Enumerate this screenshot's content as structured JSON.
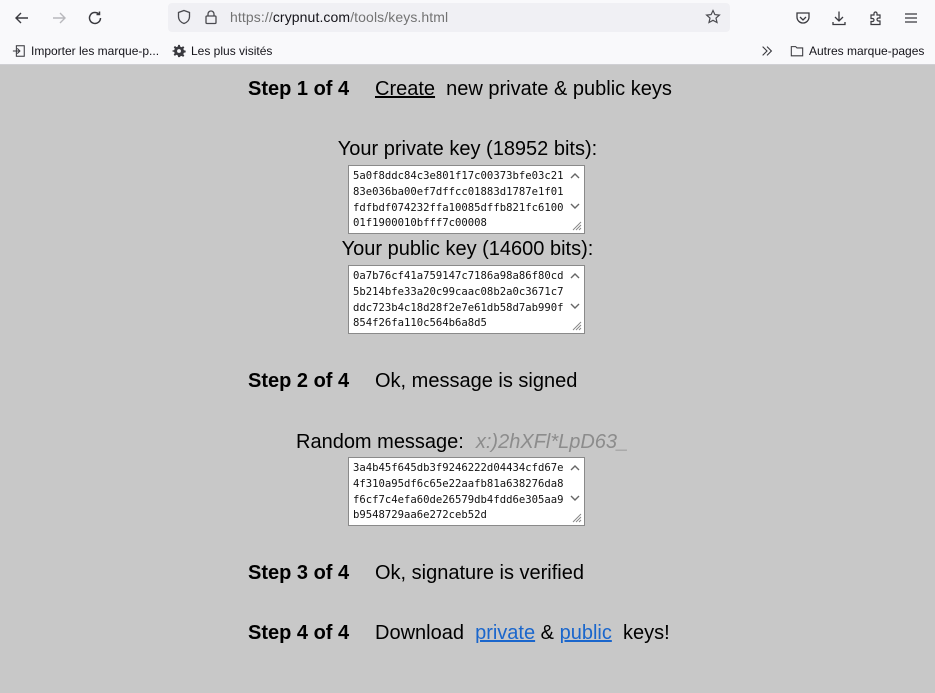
{
  "browser": {
    "url_prefix": "https://",
    "url_host": "crypnut.com",
    "url_path": "/tools/keys.html",
    "nav": {
      "back_icon": "arrow-left-icon",
      "forward_icon": "arrow-right-icon",
      "reload_icon": "reload-icon"
    },
    "url_icons": [
      "shield-icon",
      "lock-icon",
      "star-icon"
    ],
    "toolbar_icons": [
      "pocket-icon",
      "download-icon",
      "extensions-icon",
      "menu-icon"
    ],
    "bookmarks": {
      "import": "Importer les marque-p...",
      "most_visited": "Les plus visités",
      "overflow_icon": "chevron-double-right-icon",
      "other": "Autres marque-pages"
    }
  },
  "steps": [
    {
      "label": "Step 1 of 4",
      "link": "Create",
      "text": "new private & public keys"
    },
    {
      "label": "Step 2 of 4",
      "text": "Ok, message is signed"
    },
    {
      "label": "Step 3 of 4",
      "text": "Ok, signature is verified"
    },
    {
      "label": "Step 4 of 4",
      "text_before": "Download",
      "link_private": "private",
      "ampersand": "&",
      "link_public": "public",
      "text_after": "keys!"
    }
  ],
  "private_key": {
    "label": "Your private key (18952 bits):",
    "value": "5a0f8ddc84c3e801f17c00373bfe03c2183e036ba00ef7dffcc01883d1787e1f01fdfbdf074232ffa10085dffb821fc610001f1900010bfff7c00008"
  },
  "public_key": {
    "label": "Your public key (14600 bits):",
    "value": "0a7b76cf41a759147c7186a98a86f80cd5b214bfe33a20c99caac08b2a0c3671c7ddc723b4c18d28f2e7e61db58d7ab990f854f26fa110c564b6a8d5"
  },
  "signature": {
    "random_label": "Random message:",
    "random_message": "x:)2hXFl*LpD63_",
    "value": "3a4b45f645db3f9246222d04434cfd67e4f310a95df6c65e22aafb81a638276da8f6cf7c4efa60de26579db4fdd6e305aa9b9548729aa6e272ceb52d"
  },
  "colors": {
    "page_background": "#c8c8c8",
    "link_blue": "#1a66cc",
    "random_message_gray": "#8c8c8c"
  }
}
